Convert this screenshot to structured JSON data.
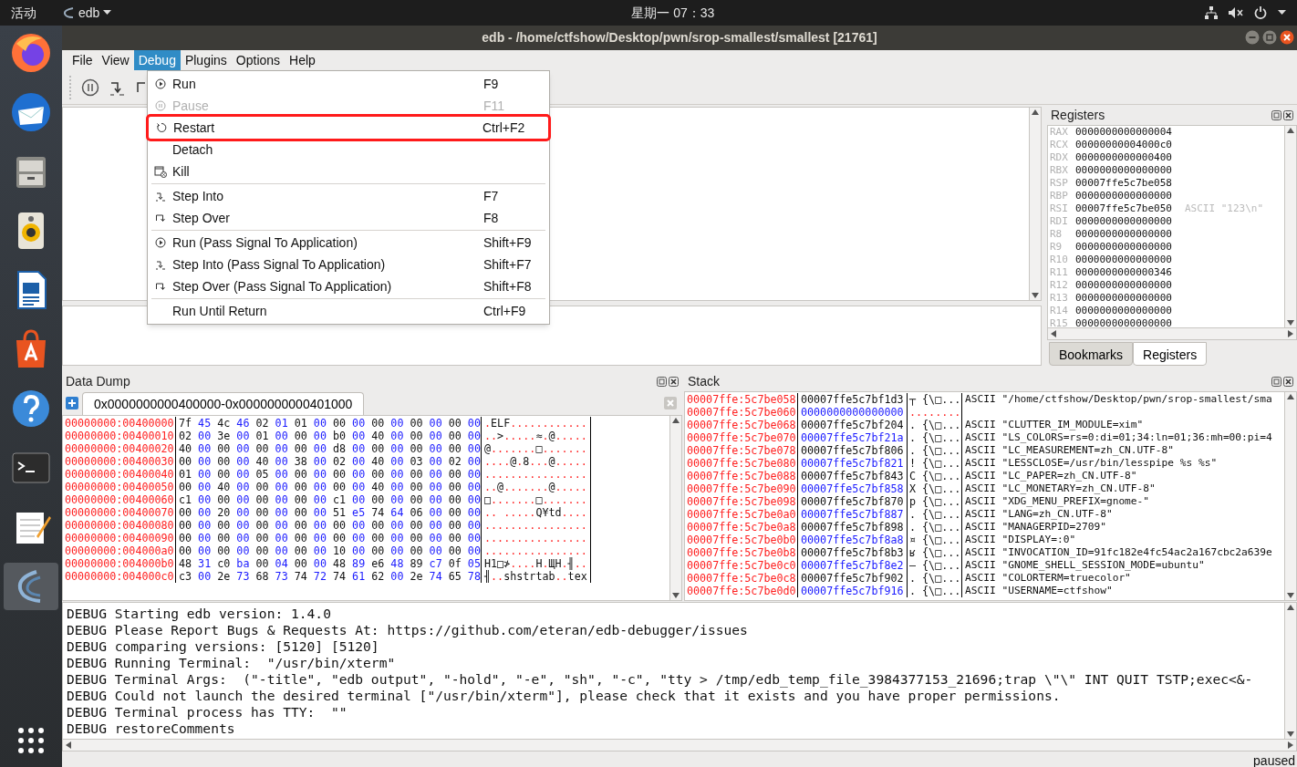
{
  "top_bar": {
    "activities": "活动",
    "app_menu": "edb",
    "clock": "星期一 07：33"
  },
  "window": {
    "title": "edb - /home/ctfshow/Desktop/pwn/srop-smallest/smallest [21761]"
  },
  "menubar": [
    {
      "label": "File",
      "selected": false
    },
    {
      "label": "View",
      "selected": false
    },
    {
      "label": "Debug",
      "selected": true
    },
    {
      "label": "Plugins",
      "selected": false
    },
    {
      "label": "Options",
      "selected": false
    },
    {
      "label": "Help",
      "selected": false
    }
  ],
  "debug_menu": [
    {
      "kind": "run",
      "label": "Run",
      "shortcut": "F9",
      "disabled": false,
      "highlighted": false
    },
    {
      "kind": "pause",
      "label": "Pause",
      "shortcut": "F11",
      "disabled": true,
      "highlighted": false
    },
    {
      "kind": "restart",
      "label": "Restart",
      "shortcut": "Ctrl+F2",
      "disabled": false,
      "highlighted": true
    },
    {
      "kind": "plain",
      "label": "Detach",
      "disabled": false,
      "highlighted": false
    },
    {
      "kind": "kill",
      "label": "Kill",
      "disabled": false,
      "highlighted": false
    },
    {
      "kind": "separator"
    },
    {
      "kind": "stepinto",
      "label": "Step Into",
      "shortcut": "F7",
      "disabled": false,
      "highlighted": false
    },
    {
      "kind": "stepover",
      "label": "Step Over",
      "shortcut": "F8",
      "disabled": false,
      "highlighted": false
    },
    {
      "kind": "separator"
    },
    {
      "kind": "run",
      "label": "Run (Pass Signal To Application)",
      "shortcut": "Shift+F9",
      "disabled": false,
      "highlighted": false
    },
    {
      "kind": "stepinto",
      "label": "Step Into (Pass Signal To Application)",
      "shortcut": "Shift+F7",
      "disabled": false,
      "highlighted": false
    },
    {
      "kind": "stepover",
      "label": "Step Over (Pass Signal To Application)",
      "shortcut": "Shift+F8",
      "disabled": false,
      "highlighted": false
    },
    {
      "kind": "separator"
    },
    {
      "kind": "plain",
      "label": "Run Until Return",
      "shortcut": "Ctrl+F9",
      "disabled": false,
      "highlighted": false
    }
  ],
  "registers": {
    "title": "Registers",
    "rows": [
      {
        "name": "RAX",
        "value": "0000000000000004"
      },
      {
        "name": "RCX",
        "value": "00000000004000c0"
      },
      {
        "name": "RDX",
        "value": "0000000000000400"
      },
      {
        "name": "RBX",
        "value": "0000000000000000"
      },
      {
        "name": "RSP",
        "value": "00007ffe5c7be058"
      },
      {
        "name": "RBP",
        "value": "0000000000000000"
      },
      {
        "name": "RSI",
        "value": "00007ffe5c7be050",
        "comment": "ASCII \"123\\n\""
      },
      {
        "name": "RDI",
        "value": "0000000000000000"
      },
      {
        "name": "R8",
        "value": "0000000000000000"
      },
      {
        "name": "R9",
        "value": "0000000000000000"
      },
      {
        "name": "R10",
        "value": "0000000000000000"
      },
      {
        "name": "R11",
        "value": "0000000000000346"
      },
      {
        "name": "R12",
        "value": "0000000000000000"
      },
      {
        "name": "R13",
        "value": "0000000000000000"
      },
      {
        "name": "R14",
        "value": "0000000000000000"
      },
      {
        "name": "R15",
        "value": "0000000000000000"
      }
    ],
    "tabs": [
      {
        "label": "Bookmarks",
        "selected": false
      },
      {
        "label": "Registers",
        "selected": true
      }
    ]
  },
  "data_dump": {
    "title": "Data Dump",
    "tab": "0x0000000000400000-0x0000000000401000",
    "rows": [
      {
        "address": "00000000:00400000",
        "hex": "7f 45 4c 46 02 01 01 00 00 00 00 00 00 00 00 00",
        "ascii": ".ELF............"
      },
      {
        "address": "00000000:00400010",
        "hex": "02 00 3e 00 01 00 00 00 b0 00 40 00 00 00 00 00",
        "ascii": "..>.....≈.@....."
      },
      {
        "address": "00000000:00400020",
        "hex": "40 00 00 00 00 00 00 00 d8 00 00 00 00 00 00 00",
        "ascii": "@.......□......."
      },
      {
        "address": "00000000:00400030",
        "hex": "00 00 00 00 40 00 38 00 02 00 40 00 03 00 02 00",
        "ascii": "....@.8...@....."
      },
      {
        "address": "00000000:00400040",
        "hex": "01 00 00 00 05 00 00 00 00 00 00 00 00 00 00 00",
        "ascii": "................"
      },
      {
        "address": "00000000:00400050",
        "hex": "00 00 40 00 00 00 00 00 00 00 40 00 00 00 00 00",
        "ascii": "..@.......@....."
      },
      {
        "address": "00000000:00400060",
        "hex": "c1 00 00 00 00 00 00 00 c1 00 00 00 00 00 00 00",
        "ascii": "□.......□......."
      },
      {
        "address": "00000000:00400070",
        "hex": "00 00 20 00 00 00 00 00 51 e5 74 64 06 00 00 00",
        "ascii": ".. .....Q¥td...."
      },
      {
        "address": "00000000:00400080",
        "hex": "00 00 00 00 00 00 00 00 00 00 00 00 00 00 00 00",
        "ascii": "................"
      },
      {
        "address": "00000000:00400090",
        "hex": "00 00 00 00 00 00 00 00 00 00 00 00 00 00 00 00",
        "ascii": "................"
      },
      {
        "address": "00000000:004000a0",
        "hex": "00 00 00 00 00 00 00 00 10 00 00 00 00 00 00 00",
        "ascii": "................"
      },
      {
        "address": "00000000:004000b0",
        "hex": "48 31 c0 ba 00 04 00 00 48 89 e6 48 89 c7 0f 05",
        "ascii": "H1□≯....H.ЩH.╢.."
      },
      {
        "address": "00000000:004000c0",
        "hex": "c3 00 2e 73 68 73 74 72 74 61 62 00 2e 74 65 78",
        "ascii": "╢..shstrtab..tex"
      }
    ]
  },
  "stack": {
    "title": "Stack",
    "rows": [
      {
        "address": "00007ffe:5c7be058",
        "value": "00007ffe5c7bf1d3",
        "chars": "┬ {\\□...",
        "comment": "ASCII \"/home/ctfshow/Desktop/pwn/srop-smallest/sma"
      },
      {
        "address": "00007ffe:5c7be060",
        "value": "0000000000000000",
        "chars": "........"
      },
      {
        "address": "00007ffe:5c7be068",
        "value": "00007ffe5c7bf204",
        "chars": ". {\\□...",
        "comment": "ASCII \"CLUTTER_IM_MODULE=xim\""
      },
      {
        "address": "00007ffe:5c7be070",
        "value": "00007ffe5c7bf21a",
        "chars": ". {\\□...",
        "comment": "ASCII \"LS_COLORS=rs=0:di=01;34:ln=01;36:mh=00:pi=4"
      },
      {
        "address": "00007ffe:5c7be078",
        "value": "00007ffe5c7bf806",
        "chars": ". {\\□...",
        "comment": "ASCII \"LC_MEASUREMENT=zh_CN.UTF-8\""
      },
      {
        "address": "00007ffe:5c7be080",
        "value": "00007ffe5c7bf821",
        "chars": "! {\\□...",
        "comment": "ASCII \"LESSCLOSE=/usr/bin/lesspipe %s %s\""
      },
      {
        "address": "00007ffe:5c7be088",
        "value": "00007ffe5c7bf843",
        "chars": "C {\\□...",
        "comment": "ASCII \"LC_PAPER=zh_CN.UTF-8\""
      },
      {
        "address": "00007ffe:5c7be090",
        "value": "00007ffe5c7bf858",
        "chars": "X {\\□...",
        "comment": "ASCII \"LC_MONETARY=zh_CN.UTF-8\""
      },
      {
        "address": "00007ffe:5c7be098",
        "value": "00007ffe5c7bf870",
        "chars": "p {\\□...",
        "comment": "ASCII \"XDG_MENU_PREFIX=gnome-\""
      },
      {
        "address": "00007ffe:5c7be0a0",
        "value": "00007ffe5c7bf887",
        "chars": ". {\\□...",
        "comment": "ASCII \"LANG=zh_CN.UTF-8\""
      },
      {
        "address": "00007ffe:5c7be0a8",
        "value": "00007ffe5c7bf898",
        "chars": ". {\\□...",
        "comment": "ASCII \"MANAGERPID=2709\""
      },
      {
        "address": "00007ffe:5c7be0b0",
        "value": "00007ffe5c7bf8a8",
        "chars": "¤ {\\□...",
        "comment": "ASCII \"DISPLAY=:0\""
      },
      {
        "address": "00007ffe:5c7be0b8",
        "value": "00007ffe5c7bf8b3",
        "chars": "ʁ {\\□...",
        "comment": "ASCII \"INVOCATION_ID=91fc182e4fc54ac2a167cbc2a639e"
      },
      {
        "address": "00007ffe:5c7be0c0",
        "value": "00007ffe5c7bf8e2",
        "chars": "– {\\□...",
        "comment": "ASCII \"GNOME_SHELL_SESSION_MODE=ubuntu\""
      },
      {
        "address": "00007ffe:5c7be0c8",
        "value": "00007ffe5c7bf902",
        "chars": ". {\\□...",
        "comment": "ASCII \"COLORTERM=truecolor\""
      },
      {
        "address": "00007ffe:5c7be0d0",
        "value": "00007ffe5c7bf916",
        "chars": ". {\\□...",
        "comment": "ASCII \"USERNAME=ctfshow\""
      }
    ]
  },
  "console": [
    "DEBUG Starting edb version: 1.4.0",
    "DEBUG Please Report Bugs & Requests At: https://github.com/eteran/edb-debugger/issues",
    "DEBUG comparing versions: [5120] [5120]",
    "DEBUG Running Terminal:  \"/usr/bin/xterm\"",
    "DEBUG Terminal Args:  (\"-title\", \"edb output\", \"-hold\", \"-e\", \"sh\", \"-c\", \"tty > /tmp/edb_temp_file_3984377153_21696;trap \\\"\\\" INT QUIT TSTP;exec<&-",
    "DEBUG Could not launch the desired terminal [\"/usr/bin/xterm\"], please check that it exists and you have proper permissions.",
    "DEBUG Terminal process has TTY:  \"\"",
    "DEBUG restoreComments"
  ],
  "status_bar": "paused"
}
